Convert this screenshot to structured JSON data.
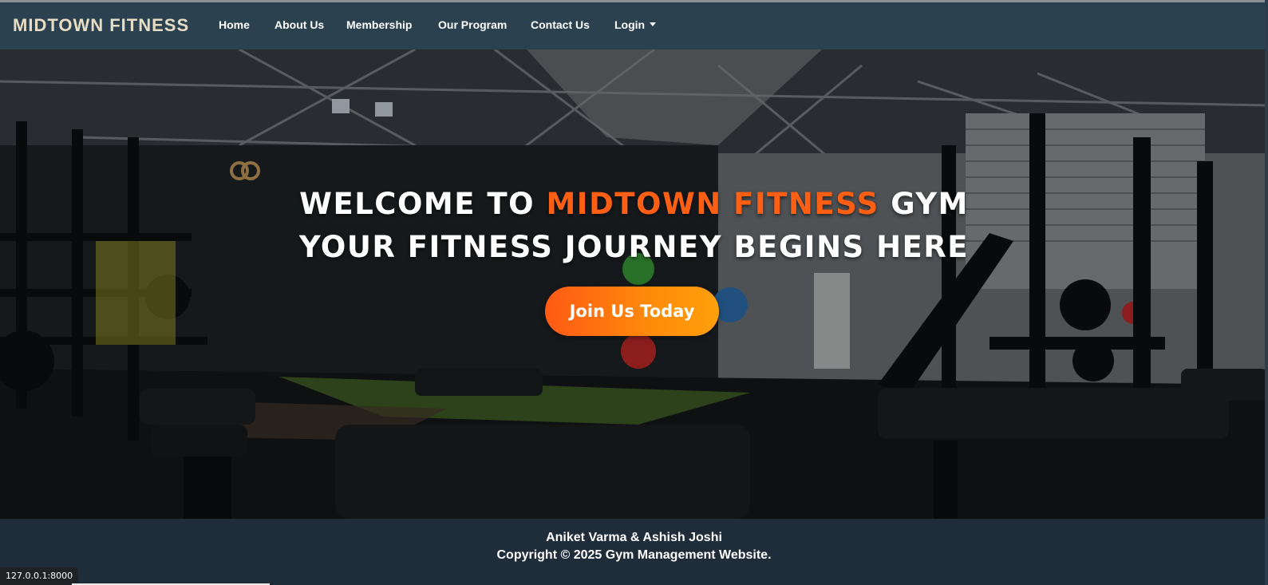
{
  "navbar": {
    "brand": "MIDTOWN FITNESS",
    "links": [
      {
        "label": "Home"
      },
      {
        "label": "About Us"
      },
      {
        "label": "Membership"
      },
      {
        "label": "Our Program"
      },
      {
        "label": "Contact Us"
      },
      {
        "label": "Login"
      }
    ],
    "background": "#2b4150",
    "brand_color": "#e6ddc4"
  },
  "hero": {
    "line1_prefix": "WELCOME TO",
    "line1_accent": "MIDTOWN FITNESS",
    "line1_suffix": "GYM",
    "line2": "YOUR FITNESS JOURNEY BEGINS HERE",
    "cta_label": "Join Us Today",
    "accent_color": "#ff5f12",
    "background_image": "gym-interior-photo"
  },
  "footer": {
    "names": "Aniket Varma & Ashish Joshi",
    "copyright": "Copyright © 2025 Gym Management Website."
  },
  "browser": {
    "status_url": "127.0.0.1:8000"
  }
}
